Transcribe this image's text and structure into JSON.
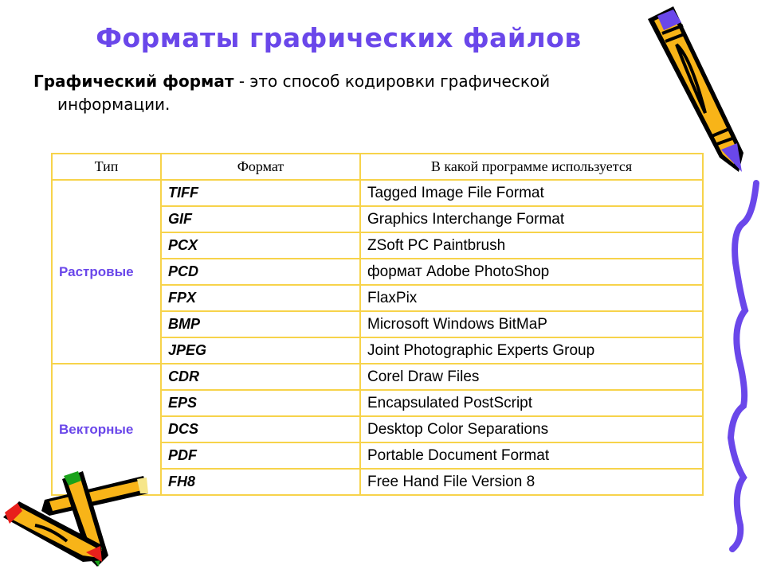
{
  "slide": {
    "title": "Форматы графических файлов",
    "definition": {
      "term": "Графический формат",
      "rest_line1": " - это способ кодировки графической",
      "line2": "информации."
    }
  },
  "table": {
    "headers": [
      "Тип",
      "Формат",
      "В какой программе используется"
    ],
    "groups": [
      {
        "type": "Растровые",
        "rows": [
          {
            "format": "TIFF",
            "program": "Tagged Image File Format"
          },
          {
            "format": "GIF",
            "program": "Graphics Interchange Format"
          },
          {
            "format": "PCX",
            "program": "ZSoft PC Paintbrush"
          },
          {
            "format": "PCD",
            "program": "формат Adobe PhotoShop"
          },
          {
            "format": "FPX",
            "program": "FlaxPix"
          },
          {
            "format": "BMP",
            "program": "Microsoft Windows BitMaP"
          },
          {
            "format": "JPEG",
            "program": "Joint Photographic Experts Group"
          }
        ]
      },
      {
        "type": "Векторные",
        "rows": [
          {
            "format": "CDR",
            "program": "Corel Draw Files"
          },
          {
            "format": "EPS",
            "program": "Encapsulated PostScript"
          },
          {
            "format": "DCS",
            "program": "Desktop Color Separations"
          },
          {
            "format": "PDF",
            "program": "Portable Document Format"
          },
          {
            "format": "FH8",
            "program": "Free Hand File Version 8"
          }
        ]
      }
    ]
  },
  "colors": {
    "accent": "#6a47ea",
    "table_border": "#f7d34a",
    "pencil_body": "#f8b418",
    "pencil_tip_red": "#e8201c",
    "pencil_tip_green": "#1aa21a"
  },
  "decorations": {
    "top_right": "pencil-icon",
    "right_edge": "squiggle-line",
    "bottom_left": "crossed-pencils-icon"
  }
}
